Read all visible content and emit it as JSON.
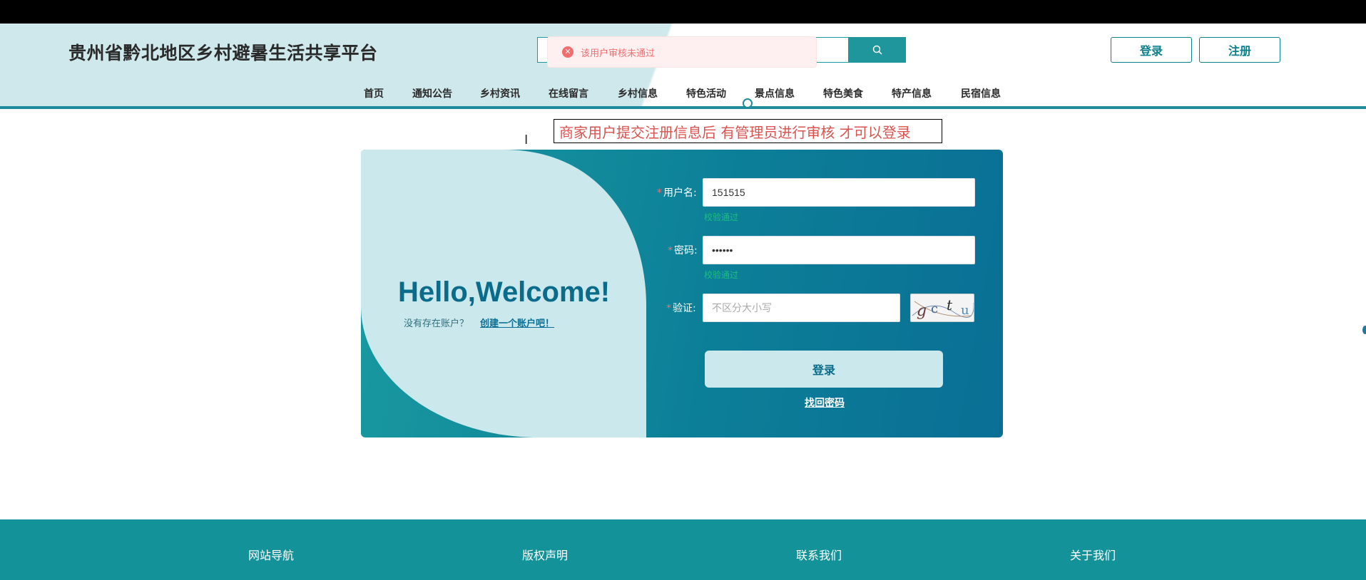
{
  "header": {
    "title": "贵州省黔北地区乡村避暑生活共享平台",
    "login_label": "登录",
    "register_label": "注册"
  },
  "nav": {
    "items": [
      "首页",
      "通知公告",
      "乡村资讯",
      "在线留言",
      "乡村信息",
      "特色活动",
      "景点信息",
      "特色美食",
      "特产信息",
      "民宿信息"
    ]
  },
  "toast": {
    "message": "该用户审核未通过"
  },
  "note": {
    "text": "商家用户提交注册信息后 有管理员进行审核 才可以登录"
  },
  "panel": {
    "welcome": "Hello,Welcome!",
    "no_account": "没有存在账户？",
    "create_account": "创建一个账户吧！"
  },
  "form": {
    "required_mark": "*",
    "username_label": "用户名:",
    "username_value": "151515",
    "username_hint": "校验通过",
    "password_label": "密码:",
    "password_value": "••••••",
    "password_hint": "校验通过",
    "captcha_label": "验证:",
    "captcha_placeholder": "不区分大小写",
    "login_button": "登录",
    "forgot_password": "找回密码"
  },
  "captcha": {
    "chars": [
      "g",
      "c",
      "t",
      "u"
    ]
  },
  "footer": {
    "items": [
      "网站导航",
      "版权声明",
      "联系我们",
      "关于我们"
    ]
  },
  "colors": {
    "accent": "#14929a",
    "panel_dark": "#0a6f95",
    "panel_light": "#cbe9ec",
    "error": "#f56c6c",
    "note_text": "#d9534f",
    "hint": "#1bbf7a"
  }
}
